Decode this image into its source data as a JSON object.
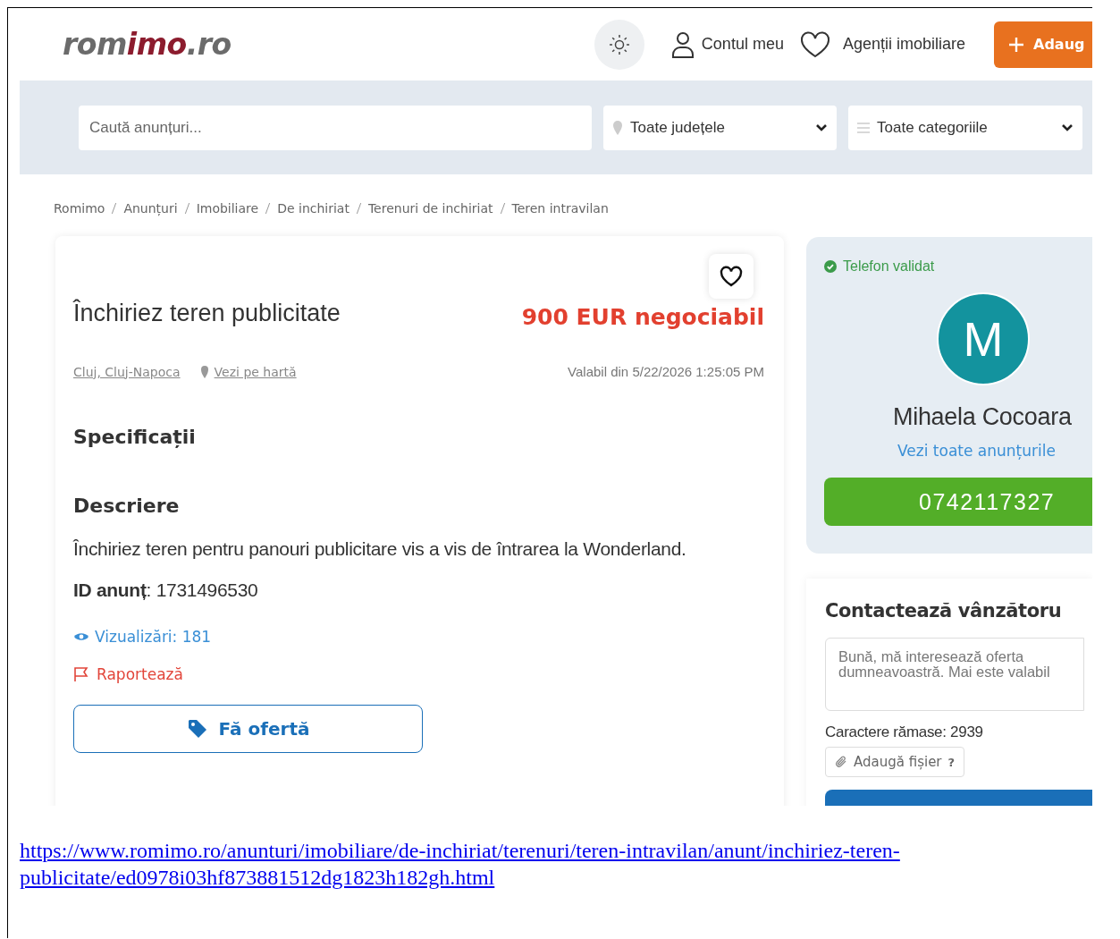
{
  "logo": {
    "start": "rom",
    "accent": "imo",
    "end": ".ro"
  },
  "header": {
    "account": "Contul meu",
    "agencies": "Agenții imobiliare",
    "add_button": "Adaug"
  },
  "search": {
    "placeholder": "Caută anunțuri...",
    "county": "Toate județele",
    "category": "Toate categoriile"
  },
  "breadcrumbs": [
    "Romimo",
    "Anunțuri",
    "Imobiliare",
    "De inchiriat",
    "Terenuri de inchiriat",
    "Teren intravilan"
  ],
  "listing": {
    "title": "Închiriez teren publicitate",
    "price": "900 EUR negociabil",
    "location": "Cluj, Cluj-Napoca",
    "map_link": "Vezi pe hartă",
    "valid": "Valabil din 5/22/2026 1:25:05 PM",
    "specs_heading": "Specificații",
    "description_heading": "Descriere",
    "description": "Închiriez teren pentru panouri publicitare vis a vis de întrarea la Wonderland.",
    "id_line": "**ID anunț**: 1731496530",
    "views": "Vizualizări: 181",
    "report": "Raportează",
    "offer_button": "Fă ofertă"
  },
  "seller": {
    "phone_status": "Telefon validat",
    "initial": "M",
    "name": "Mihaela Cocoara",
    "all_ads": "Vezi toate anunțurile",
    "phone": "0742117327"
  },
  "contact": {
    "heading": "Contactează vânzătoru",
    "placeholder": "Bună, mă interesează oferta dumneavoastră. Mai este valabil",
    "remaining": "Caractere rămase: 2939",
    "attach": "Adaugă fișier",
    "help": "?"
  },
  "footer_url": "https://www.romimo.ro/anunturi/imobiliare/de-inchiriat/terenuri/teren-intravilan/anunt/inchiriez-teren-publicitate/ed0978i03hf873881512dg1823h182gh.html"
}
